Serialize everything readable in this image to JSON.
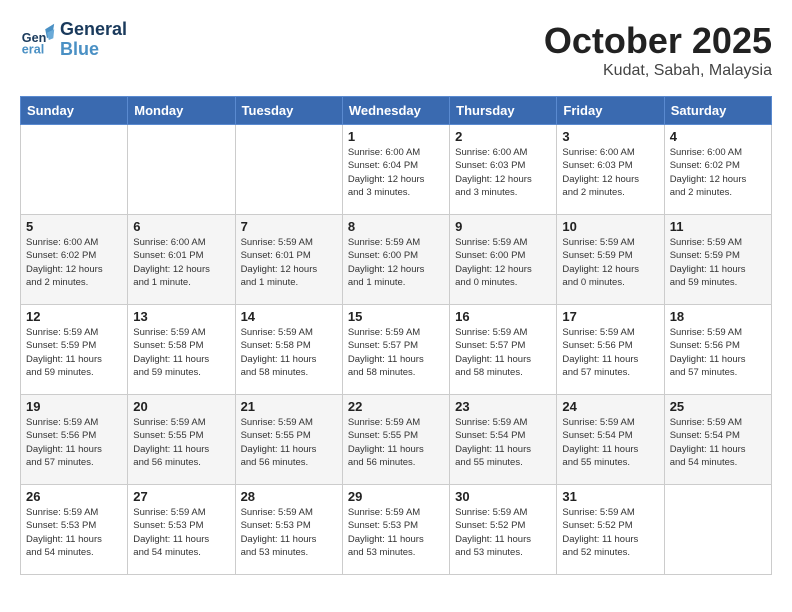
{
  "header": {
    "logo_general": "General",
    "logo_blue": "Blue",
    "month_title": "October 2025",
    "location": "Kudat, Sabah, Malaysia"
  },
  "days_of_week": [
    "Sunday",
    "Monday",
    "Tuesday",
    "Wednesday",
    "Thursday",
    "Friday",
    "Saturday"
  ],
  "weeks": [
    [
      {
        "day": "",
        "info": ""
      },
      {
        "day": "",
        "info": ""
      },
      {
        "day": "",
        "info": ""
      },
      {
        "day": "1",
        "info": "Sunrise: 6:00 AM\nSunset: 6:04 PM\nDaylight: 12 hours\nand 3 minutes."
      },
      {
        "day": "2",
        "info": "Sunrise: 6:00 AM\nSunset: 6:03 PM\nDaylight: 12 hours\nand 3 minutes."
      },
      {
        "day": "3",
        "info": "Sunrise: 6:00 AM\nSunset: 6:03 PM\nDaylight: 12 hours\nand 2 minutes."
      },
      {
        "day": "4",
        "info": "Sunrise: 6:00 AM\nSunset: 6:02 PM\nDaylight: 12 hours\nand 2 minutes."
      }
    ],
    [
      {
        "day": "5",
        "info": "Sunrise: 6:00 AM\nSunset: 6:02 PM\nDaylight: 12 hours\nand 2 minutes."
      },
      {
        "day": "6",
        "info": "Sunrise: 6:00 AM\nSunset: 6:01 PM\nDaylight: 12 hours\nand 1 minute."
      },
      {
        "day": "7",
        "info": "Sunrise: 5:59 AM\nSunset: 6:01 PM\nDaylight: 12 hours\nand 1 minute."
      },
      {
        "day": "8",
        "info": "Sunrise: 5:59 AM\nSunset: 6:00 PM\nDaylight: 12 hours\nand 1 minute."
      },
      {
        "day": "9",
        "info": "Sunrise: 5:59 AM\nSunset: 6:00 PM\nDaylight: 12 hours\nand 0 minutes."
      },
      {
        "day": "10",
        "info": "Sunrise: 5:59 AM\nSunset: 5:59 PM\nDaylight: 12 hours\nand 0 minutes."
      },
      {
        "day": "11",
        "info": "Sunrise: 5:59 AM\nSunset: 5:59 PM\nDaylight: 11 hours\nand 59 minutes."
      }
    ],
    [
      {
        "day": "12",
        "info": "Sunrise: 5:59 AM\nSunset: 5:59 PM\nDaylight: 11 hours\nand 59 minutes."
      },
      {
        "day": "13",
        "info": "Sunrise: 5:59 AM\nSunset: 5:58 PM\nDaylight: 11 hours\nand 59 minutes."
      },
      {
        "day": "14",
        "info": "Sunrise: 5:59 AM\nSunset: 5:58 PM\nDaylight: 11 hours\nand 58 minutes."
      },
      {
        "day": "15",
        "info": "Sunrise: 5:59 AM\nSunset: 5:57 PM\nDaylight: 11 hours\nand 58 minutes."
      },
      {
        "day": "16",
        "info": "Sunrise: 5:59 AM\nSunset: 5:57 PM\nDaylight: 11 hours\nand 58 minutes."
      },
      {
        "day": "17",
        "info": "Sunrise: 5:59 AM\nSunset: 5:56 PM\nDaylight: 11 hours\nand 57 minutes."
      },
      {
        "day": "18",
        "info": "Sunrise: 5:59 AM\nSunset: 5:56 PM\nDaylight: 11 hours\nand 57 minutes."
      }
    ],
    [
      {
        "day": "19",
        "info": "Sunrise: 5:59 AM\nSunset: 5:56 PM\nDaylight: 11 hours\nand 57 minutes."
      },
      {
        "day": "20",
        "info": "Sunrise: 5:59 AM\nSunset: 5:55 PM\nDaylight: 11 hours\nand 56 minutes."
      },
      {
        "day": "21",
        "info": "Sunrise: 5:59 AM\nSunset: 5:55 PM\nDaylight: 11 hours\nand 56 minutes."
      },
      {
        "day": "22",
        "info": "Sunrise: 5:59 AM\nSunset: 5:55 PM\nDaylight: 11 hours\nand 56 minutes."
      },
      {
        "day": "23",
        "info": "Sunrise: 5:59 AM\nSunset: 5:54 PM\nDaylight: 11 hours\nand 55 minutes."
      },
      {
        "day": "24",
        "info": "Sunrise: 5:59 AM\nSunset: 5:54 PM\nDaylight: 11 hours\nand 55 minutes."
      },
      {
        "day": "25",
        "info": "Sunrise: 5:59 AM\nSunset: 5:54 PM\nDaylight: 11 hours\nand 54 minutes."
      }
    ],
    [
      {
        "day": "26",
        "info": "Sunrise: 5:59 AM\nSunset: 5:53 PM\nDaylight: 11 hours\nand 54 minutes."
      },
      {
        "day": "27",
        "info": "Sunrise: 5:59 AM\nSunset: 5:53 PM\nDaylight: 11 hours\nand 54 minutes."
      },
      {
        "day": "28",
        "info": "Sunrise: 5:59 AM\nSunset: 5:53 PM\nDaylight: 11 hours\nand 53 minutes."
      },
      {
        "day": "29",
        "info": "Sunrise: 5:59 AM\nSunset: 5:53 PM\nDaylight: 11 hours\nand 53 minutes."
      },
      {
        "day": "30",
        "info": "Sunrise: 5:59 AM\nSunset: 5:52 PM\nDaylight: 11 hours\nand 53 minutes."
      },
      {
        "day": "31",
        "info": "Sunrise: 5:59 AM\nSunset: 5:52 PM\nDaylight: 11 hours\nand 52 minutes."
      },
      {
        "day": "",
        "info": ""
      }
    ]
  ]
}
